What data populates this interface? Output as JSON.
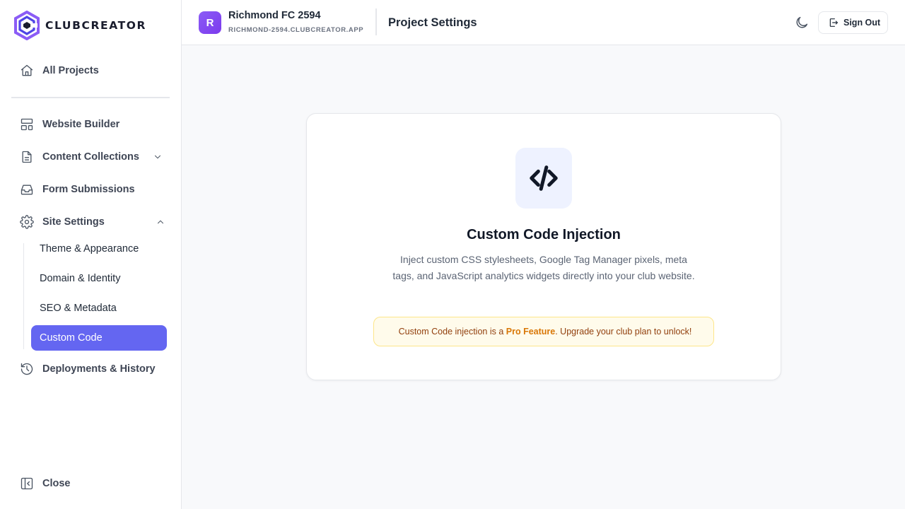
{
  "brand": {
    "name": "CLUBCREATOR",
    "accent": "#6466f1",
    "logo_color": "#7c3aed"
  },
  "sidebar": {
    "all_projects": "All Projects",
    "website_builder": "Website Builder",
    "content_collections": "Content Collections",
    "form_submissions": "Form Submissions",
    "site_settings": "Site Settings",
    "sub_items": [
      "Theme & Appearance",
      "Domain & Identity",
      "SEO & Metadata",
      "Custom Code"
    ],
    "active_sub_item": "Custom Code",
    "deployments": "Deployments & History",
    "close": "Close"
  },
  "header": {
    "project_initial": "R",
    "project_name": "Richmond FC 2594",
    "project_domain": "RICHMOND-2594.CLUBCREATOR.APP",
    "page_title": "Project Settings",
    "sign_out": "Sign Out"
  },
  "card": {
    "title": "Custom Code Injection",
    "description": "Inject custom CSS stylesheets, Google Tag Manager pixels, meta tags, and JavaScript analytics widgets directly into your club website.",
    "banner_prefix": "Custom Code injection is a ",
    "banner_highlight": "Pro Feature",
    "banner_suffix": ". Upgrade your club plan to unlock!"
  },
  "icons": {
    "logo": "hexagon-c-logo",
    "all_projects": "home-icon",
    "website_builder": "layout-icon",
    "content_collections": "file-text-icon",
    "form_submissions": "inbox-icon",
    "site_settings": "gear-icon",
    "deployments": "history-icon",
    "close": "sidebar-collapse-icon",
    "theme": "moon-icon",
    "sign_out": "log-out-icon",
    "code": "code-icon"
  }
}
